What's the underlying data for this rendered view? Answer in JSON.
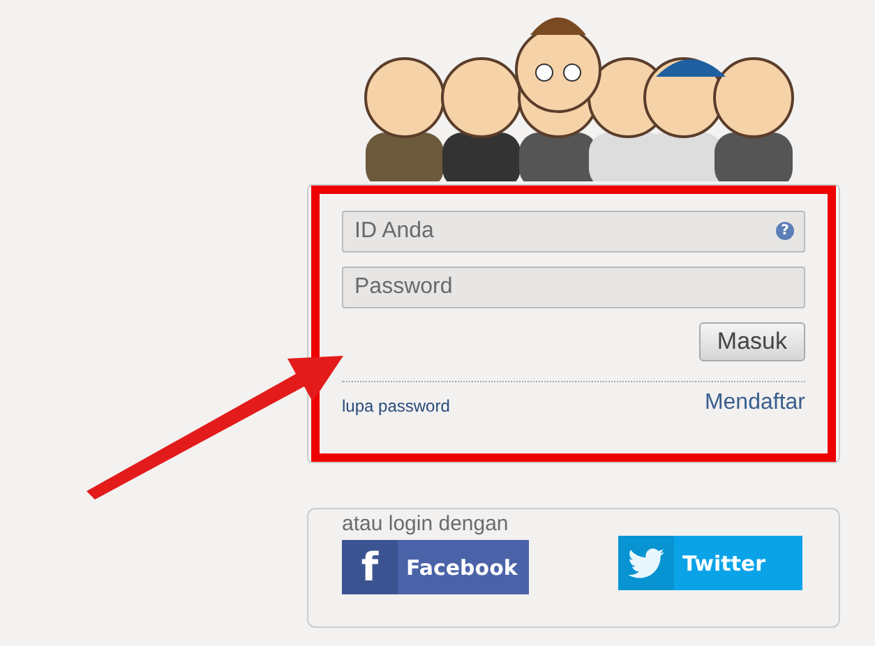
{
  "login": {
    "id_field": {
      "placeholder": "ID Anda",
      "help_icon": "?"
    },
    "password_field": {
      "placeholder": "Password"
    },
    "submit": "Masuk",
    "forgot_link": "lupa password",
    "register_link": "Mendaftar"
  },
  "social": {
    "prompt": "atau login dengan",
    "buttons": [
      {
        "kind": "facebook",
        "icon": "f",
        "label": "Facebook"
      },
      {
        "kind": "twitter",
        "label": "Twitter"
      }
    ]
  }
}
